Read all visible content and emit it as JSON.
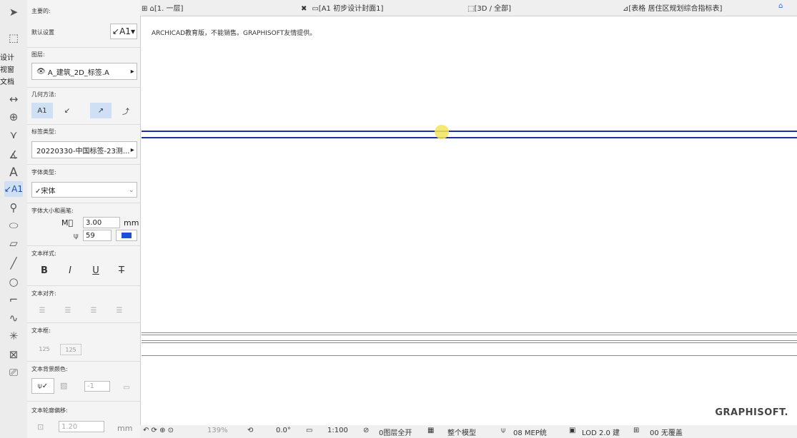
{
  "colors": {
    "accent": "#1b2fa8",
    "highlight": "#f4e55a",
    "panel": "#f4f4f4"
  },
  "toolbox": {
    "tabs": [
      "设计",
      "视窗",
      "文档"
    ],
    "tools": [
      "arrow-select-icon",
      "marquee-icon",
      "dimension-icon",
      "level-dimension-icon",
      "angle-dimension-icon",
      "slope-dimension-icon",
      "text-icon",
      "label-icon",
      "radial-dimension-icon",
      "fill-icon",
      "zone-icon",
      "line-icon",
      "circle-icon",
      "polyline-icon",
      "spline-icon",
      "hotspot-icon",
      "figure-icon",
      "drawing-icon"
    ],
    "text_tool_label": "A",
    "label_tool_label": "A1"
  },
  "info": {
    "main_label": "主要的:",
    "default_label": "默认设置",
    "default_value": "A1",
    "layer_label": "图层:",
    "layer_value": "A_建筑_2D_标签.A",
    "geometry_label": "几何方法:",
    "geo_btn": "A1",
    "label_type_label": "标签类型:",
    "label_type_value": "20220330-中国标签-23测...",
    "font_type_label": "字体类型:",
    "font_value": "✓宋体",
    "font_size_label": "字体大小和画笔:",
    "font_size": "3.00",
    "font_unit": "mm",
    "pen_value": "59",
    "text_style_label": "文本样式:",
    "style_bold": "B",
    "style_italic": "I",
    "style_underline": "U",
    "style_strike": "T",
    "align_label": "文本对齐:",
    "frame_label": "文本框:",
    "frame_a": "125",
    "frame_b": "125",
    "bg_color_label": "文本背景颜色:",
    "bg_pen": "-1",
    "offset_label": "文本轮廓偏移:",
    "offset_value": "1.20",
    "offset_unit": "mm"
  },
  "tabs": {
    "floor": "[1. 一层]",
    "layout": "[A1 初步设计封面1]",
    "view3d": "[3D / 全部]",
    "schedule": "[表格 居住区规划综合指标表]"
  },
  "canvas": {
    "watermark": "ARCHICAD教育版，不能销售。GRAPHISOFT友情提供。",
    "brand": "GRAPHISOFT."
  },
  "status": {
    "zoom": "139%",
    "angle": "0.0°",
    "scale": "1:100",
    "layers": "0图层全开",
    "model": "整个模型",
    "mep": "08 MEP统",
    "lod": "LOD 2.0 建",
    "reno": "00 无覆盖"
  }
}
